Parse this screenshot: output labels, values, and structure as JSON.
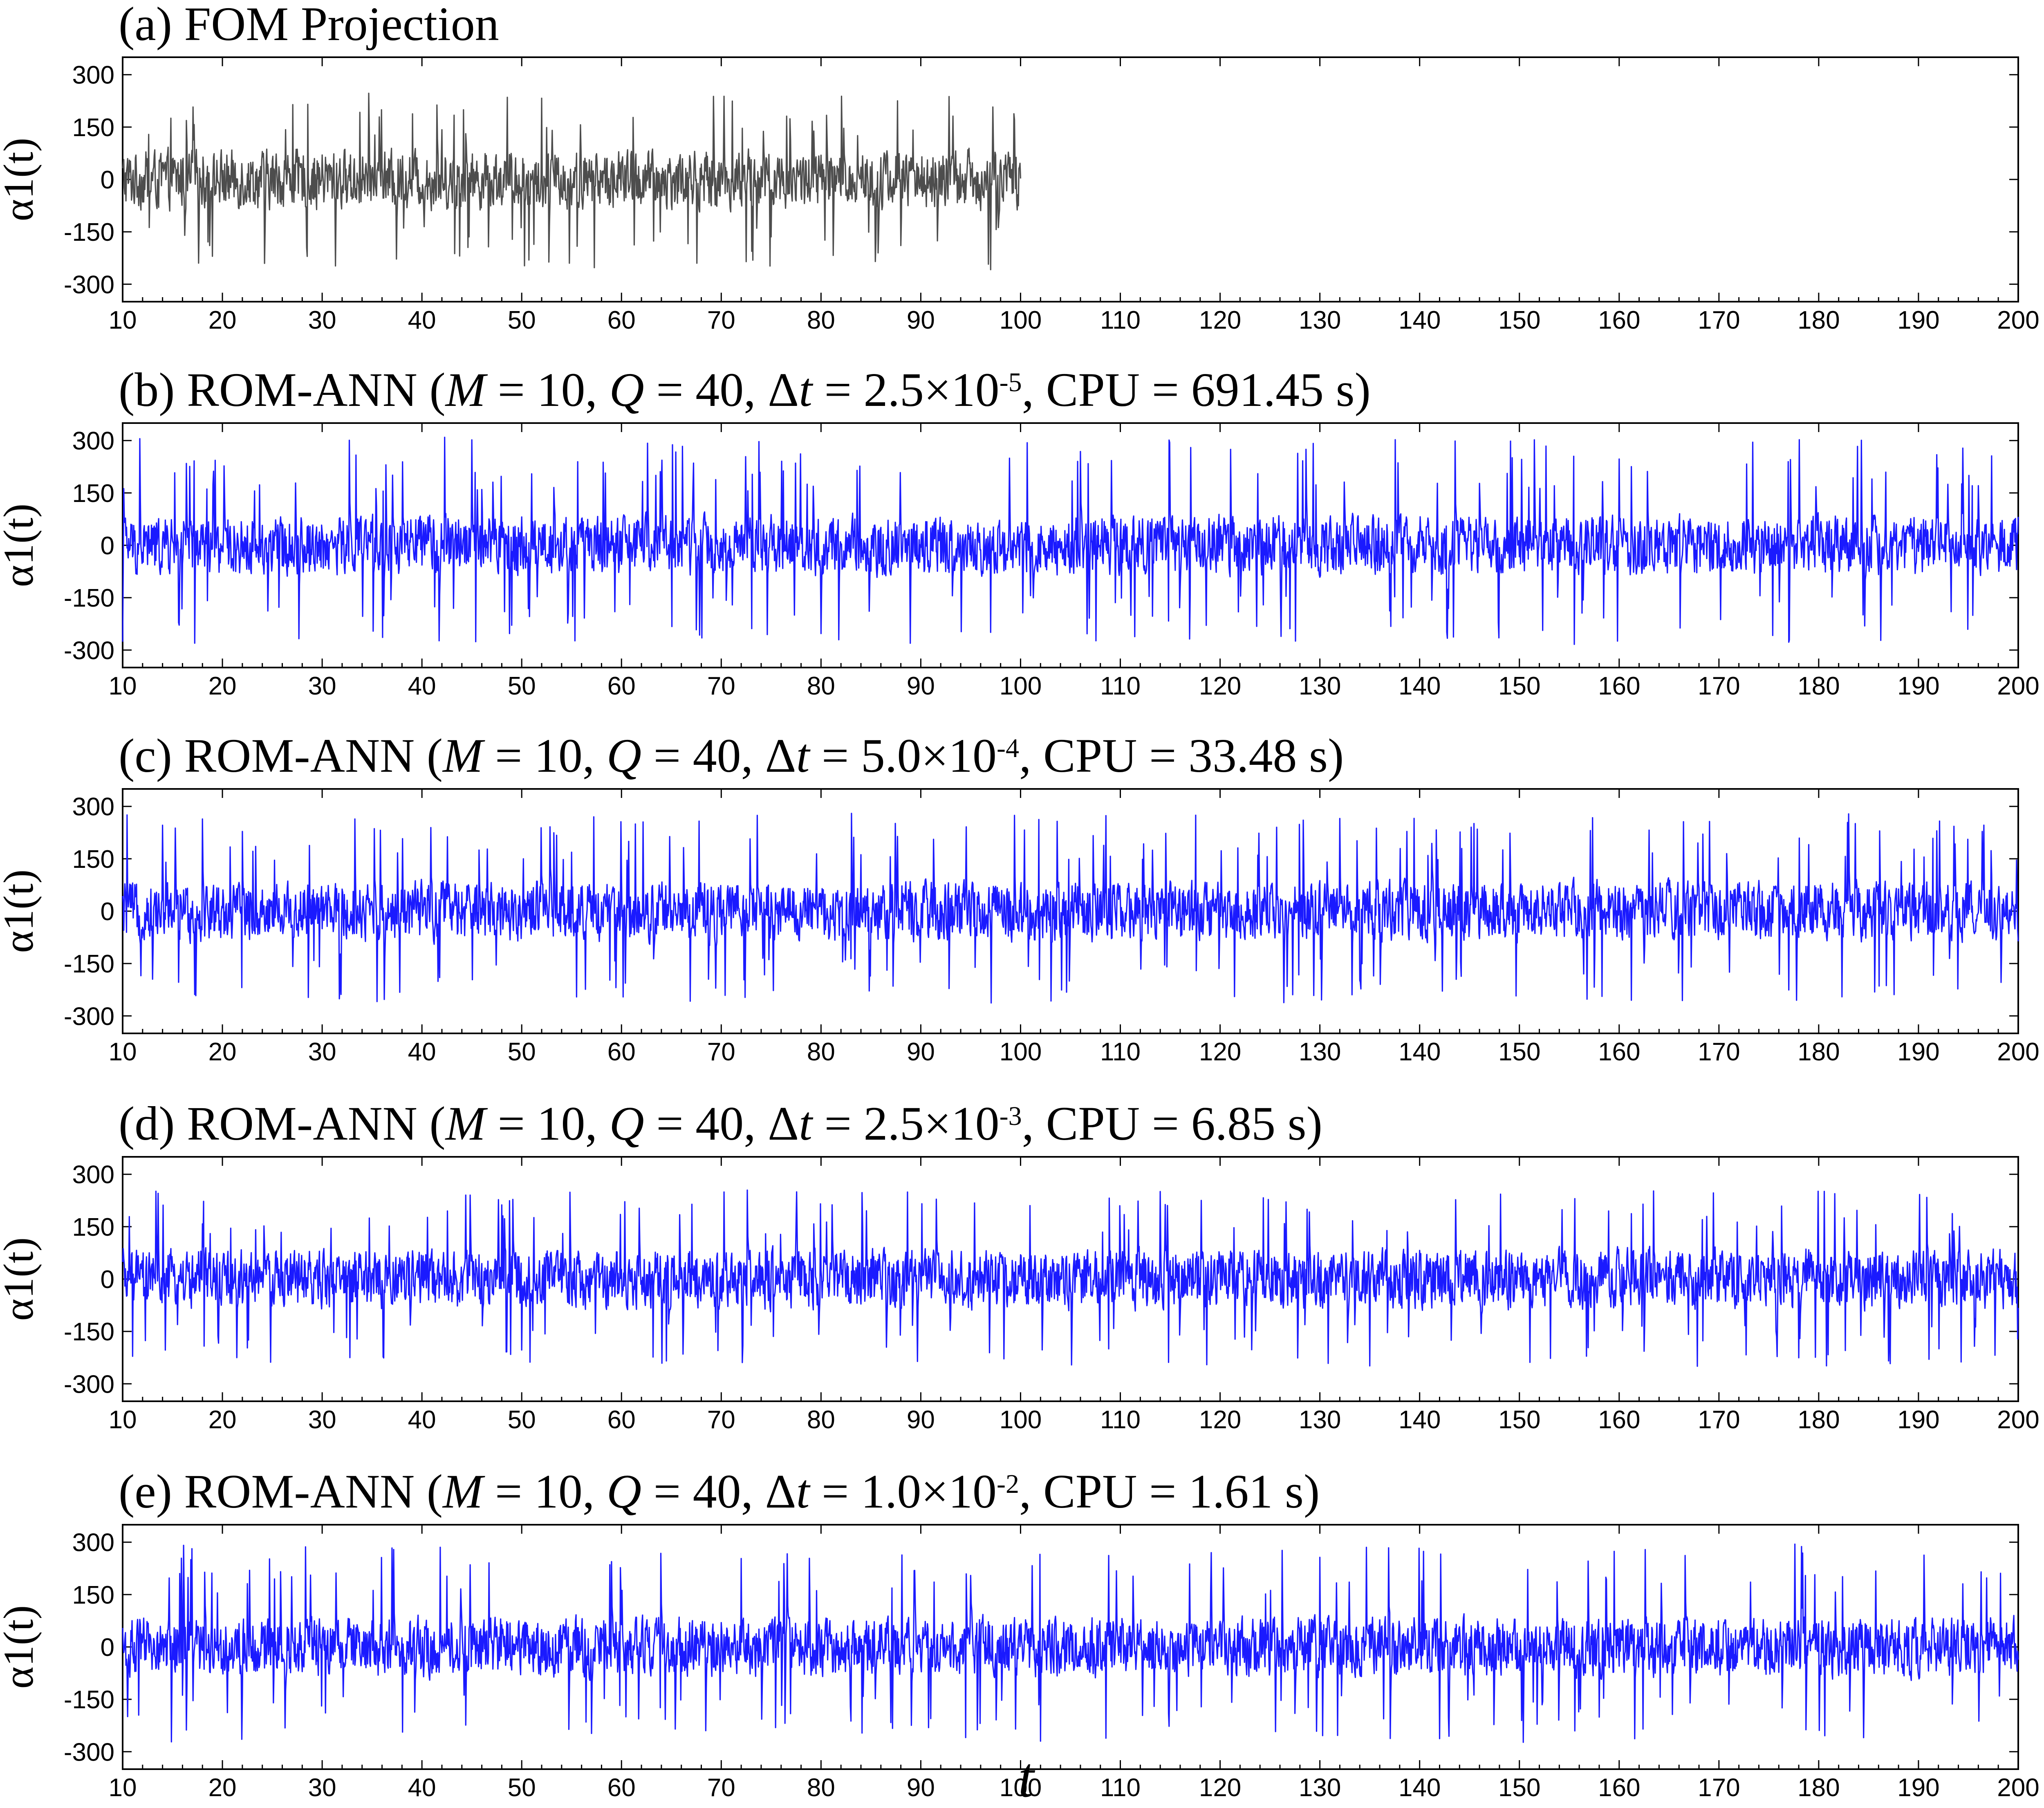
{
  "figure": {
    "xlabel": "t"
  },
  "chart_data": [
    {
      "type": "line",
      "title_prefix": "(a) FOM Projection",
      "title_parts": [],
      "ylabel": "α1(t)",
      "xlim": [
        10,
        200
      ],
      "ylim": [
        -350,
        350
      ],
      "xticks": [
        "10",
        "20",
        "30",
        "40",
        "50",
        "60",
        "70",
        "80",
        "90",
        "100",
        "110",
        "120",
        "130",
        "140",
        "150",
        "160",
        "170",
        "180",
        "190",
        "200"
      ],
      "yticks": [
        "300",
        "150",
        "0",
        "-150",
        "-300"
      ],
      "grid": false,
      "legend": "none",
      "series": [
        {
          "color": "#4d4d4d",
          "x_range": [
            10,
            100
          ],
          "amplitude_range": [
            -260,
            250
          ]
        }
      ]
    },
    {
      "type": "line",
      "title_prefix": "(b) ROM-ANN (",
      "title_parts": [
        "M",
        " = 10, ",
        "Q",
        " = 40, Δ",
        "t",
        " = 2.5×10",
        "-5",
        ", CPU = 691.45 s)"
      ],
      "ylabel": "α1(t)",
      "xlim": [
        10,
        200
      ],
      "ylim": [
        -350,
        350
      ],
      "xticks": [
        "10",
        "20",
        "30",
        "40",
        "50",
        "60",
        "70",
        "80",
        "90",
        "100",
        "110",
        "120",
        "130",
        "140",
        "150",
        "160",
        "170",
        "180",
        "190",
        "200"
      ],
      "yticks": [
        "300",
        "150",
        "0",
        "-150",
        "-300"
      ],
      "grid": false,
      "legend": "none",
      "series": [
        {
          "color": "#1a1aff",
          "x_range": [
            10,
            200
          ],
          "amplitude_range": [
            -285,
            310
          ]
        }
      ]
    },
    {
      "type": "line",
      "title_prefix": "(c) ROM-ANN (",
      "title_parts": [
        "M",
        " = 10, ",
        "Q",
        " = 40, Δ",
        "t",
        " = 5.0×10",
        "-4",
        ", CPU = 33.48 s)"
      ],
      "ylabel": "α1(t)",
      "xlim": [
        10,
        200
      ],
      "ylim": [
        -350,
        350
      ],
      "xticks": [
        "10",
        "20",
        "30",
        "40",
        "50",
        "60",
        "70",
        "80",
        "90",
        "100",
        "110",
        "120",
        "130",
        "140",
        "150",
        "160",
        "170",
        "180",
        "190",
        "200"
      ],
      "yticks": [
        "300",
        "150",
        "0",
        "-150",
        "-300"
      ],
      "grid": false,
      "legend": "none",
      "series": [
        {
          "color": "#1a1aff",
          "x_range": [
            10,
            200
          ],
          "amplitude_range": [
            -265,
            280
          ]
        }
      ]
    },
    {
      "type": "line",
      "title_prefix": "(d) ROM-ANN (",
      "title_parts": [
        "M",
        " = 10, ",
        "Q",
        " = 40, Δ",
        "t",
        " = 2.5×10",
        "-3",
        ", CPU = 6.85 s)"
      ],
      "ylabel": "α1(t)",
      "xlim": [
        10,
        200
      ],
      "ylim": [
        -350,
        350
      ],
      "xticks": [
        "10",
        "20",
        "30",
        "40",
        "50",
        "60",
        "70",
        "80",
        "90",
        "100",
        "110",
        "120",
        "130",
        "140",
        "150",
        "160",
        "170",
        "180",
        "190",
        "200"
      ],
      "yticks": [
        "300",
        "150",
        "0",
        "-150",
        "-300"
      ],
      "grid": false,
      "legend": "none",
      "series": [
        {
          "color": "#1a1aff",
          "x_range": [
            10,
            200
          ],
          "amplitude_range": [
            -250,
            255
          ]
        }
      ]
    },
    {
      "type": "line",
      "title_prefix": "(e) ROM-ANN (",
      "title_parts": [
        "M",
        " = 10, ",
        "Q",
        " = 40, Δ",
        "t",
        " = 1.0×10",
        "-2",
        ", CPU = 1.61 s)"
      ],
      "ylabel": "α1(t)",
      "xlim": [
        10,
        200
      ],
      "ylim": [
        -350,
        350
      ],
      "xticks": [
        "10",
        "20",
        "30",
        "40",
        "50",
        "60",
        "70",
        "80",
        "90",
        "100",
        "110",
        "120",
        "130",
        "140",
        "150",
        "160",
        "170",
        "180",
        "190",
        "200"
      ],
      "yticks": [
        "300",
        "150",
        "0",
        "-150",
        "-300"
      ],
      "grid": false,
      "legend": "none",
      "series": [
        {
          "color": "#1a1aff",
          "x_range": [
            10,
            200
          ],
          "amplitude_range": [
            -275,
            300
          ]
        }
      ]
    }
  ]
}
